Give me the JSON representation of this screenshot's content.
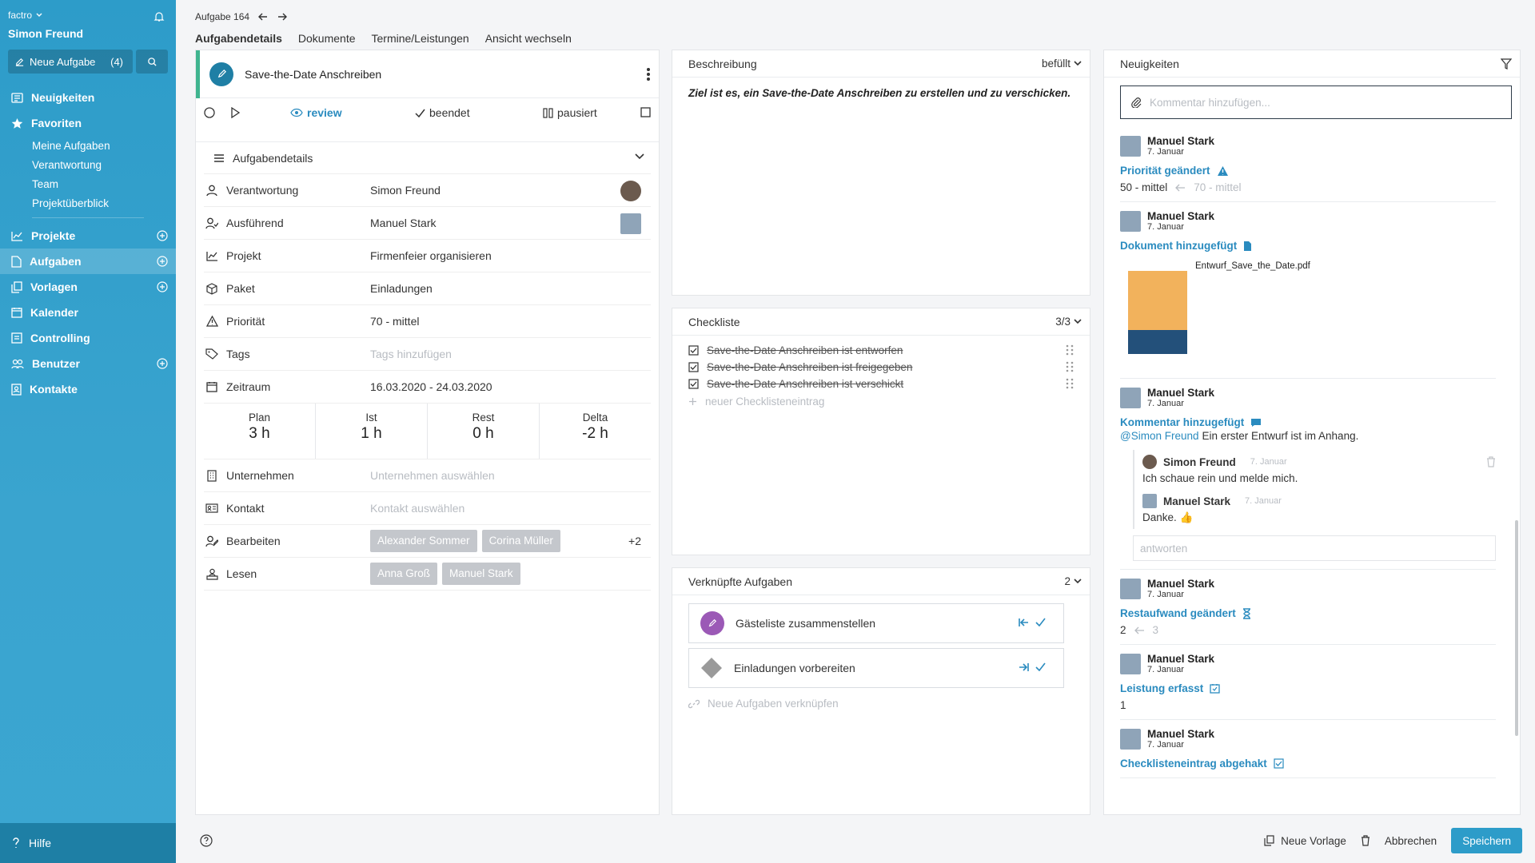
{
  "sidebar": {
    "brand": "factro",
    "user": "Simon Freund",
    "new_task_label": "Neue Aufgabe",
    "new_task_count": "(4)",
    "nav": [
      {
        "label": "Neuigkeiten"
      },
      {
        "label": "Favoriten"
      },
      {
        "label": "Projekte"
      },
      {
        "label": "Aufgaben"
      },
      {
        "label": "Vorlagen"
      },
      {
        "label": "Kalender"
      },
      {
        "label": "Controlling"
      },
      {
        "label": "Benutzer"
      },
      {
        "label": "Kontakte"
      }
    ],
    "favorites": [
      "Meine Aufgaben",
      "Verantwortung",
      "Team",
      "Projektüberblick"
    ],
    "help": "Hilfe"
  },
  "header": {
    "task_id": "Aufgabe 164",
    "tabs": [
      "Aufgabendetails",
      "Dokumente",
      "Termine/Leistungen",
      "Ansicht wechseln"
    ]
  },
  "task": {
    "title": "Save-the-Date Anschreiben",
    "status": {
      "review": "review",
      "done": "beendet",
      "paused": "pausiert"
    },
    "details_header": "Aufgabendetails",
    "rows": {
      "verantwortung": {
        "label": "Verantwortung",
        "value": "Simon Freund"
      },
      "ausfuehrend": {
        "label": "Ausführend",
        "value": "Manuel Stark"
      },
      "projekt": {
        "label": "Projekt",
        "value": "Firmenfeier organisieren"
      },
      "paket": {
        "label": "Paket",
        "value": "Einladungen"
      },
      "prioritaet": {
        "label": "Priorität",
        "value": "70 - mittel"
      },
      "tags": {
        "label": "Tags",
        "placeholder": "Tags hinzufügen"
      },
      "zeitraum": {
        "label": "Zeitraum",
        "value": "16.03.2020 - 24.03.2020"
      },
      "unternehmen": {
        "label": "Unternehmen",
        "placeholder": "Unternehmen auswählen"
      },
      "kontakt": {
        "label": "Kontakt",
        "placeholder": "Kontakt auswählen"
      },
      "bearbeiten": {
        "label": "Bearbeiten",
        "tags": [
          "Alexander Sommer",
          "Corina Müller"
        ],
        "more": "+2"
      },
      "lesen": {
        "label": "Lesen",
        "tags": [
          "Anna Groß",
          "Manuel Stark"
        ]
      }
    },
    "hours": {
      "plan": {
        "label": "Plan",
        "value": "3 h"
      },
      "ist": {
        "label": "Ist",
        "value": "1 h"
      },
      "rest": {
        "label": "Rest",
        "value": "0 h"
      },
      "delta": {
        "label": "Delta",
        "value": "-2 h"
      }
    }
  },
  "description": {
    "title": "Beschreibung",
    "filter": "befüllt",
    "text": "Ziel ist es, ein Save-the-Date Anschreiben zu erstellen und zu verschicken."
  },
  "checklist": {
    "title": "Checkliste",
    "count": "3/3",
    "items": [
      "Save-the-Date Anschreiben ist entworfen",
      "Save-the-Date Anschreiben ist freigegeben",
      "Save-the-Date Anschreiben ist verschickt"
    ],
    "new_placeholder": "neuer Checklisteneintrag"
  },
  "linked": {
    "title": "Verknüpfte Aufgaben",
    "count": "2",
    "items": [
      "Gästeliste zusammenstellen",
      "Einladungen vorbereiten"
    ],
    "new_label": "Neue Aufgaben verknüpfen"
  },
  "news": {
    "title": "Neuigkeiten",
    "comment_placeholder": "Kommentar hinzufügen...",
    "items": [
      {
        "name": "Manuel Stark",
        "date": "7. Januar",
        "action": "Priorität geändert",
        "new": "50 - mittel",
        "old": "70 - mittel"
      },
      {
        "name": "Manuel Stark",
        "date": "7. Januar",
        "action": "Dokument hinzugefügt",
        "file": "Entwurf_Save_the_Date.pdf"
      },
      {
        "name": "Manuel Stark",
        "date": "7. Januar",
        "action": "Kommentar hinzugefügt",
        "mention": "@Simon Freund",
        "comment": "Ein erster Entwurf ist im Anhang."
      },
      {
        "name": "Manuel Stark",
        "date": "7. Januar",
        "action": "Restaufwand geändert",
        "new": "2",
        "old": "3"
      },
      {
        "name": "Manuel Stark",
        "date": "7. Januar",
        "action": "Leistung erfasst",
        "new": "1"
      },
      {
        "name": "Manuel Stark",
        "date": "7. Januar",
        "action": "Checklisteneintrag abgehakt"
      }
    ],
    "replies": [
      {
        "name": "Simon Freund",
        "date": "7. Januar",
        "text": "Ich schaue rein und melde mich."
      },
      {
        "name": "Manuel Stark",
        "date": "7. Januar",
        "text": "Danke. 👍"
      }
    ],
    "reply_placeholder": "antworten"
  },
  "footer": {
    "new_template": "Neue Vorlage",
    "cancel": "Abbrechen",
    "save": "Speichern"
  },
  "colors": {
    "accent": "#2d9cc9",
    "link": "#2a8bbf",
    "task_bar": "#3fb48f"
  }
}
